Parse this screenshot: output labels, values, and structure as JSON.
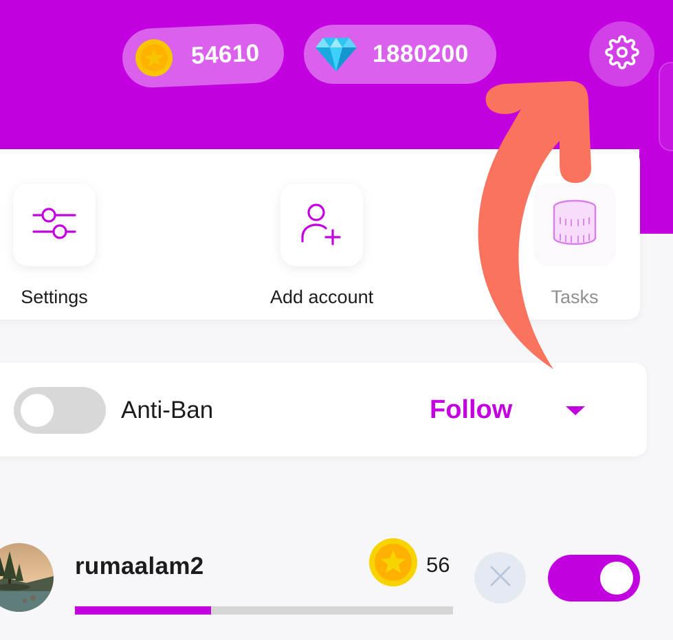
{
  "balances": {
    "coins": "54610",
    "gems": "1880200"
  },
  "icons": {
    "coin": "coin-star-icon",
    "gem": "diamond-icon",
    "settings_top": "gear-icon",
    "settings_action": "sliders-icon",
    "add_account": "user-plus-icon",
    "tasks": "coin-stack-icon",
    "dismiss": "close-icon"
  },
  "actions": [
    {
      "label": "Settings"
    },
    {
      "label": "Add account"
    },
    {
      "label": "Tasks"
    }
  ],
  "mode_bar": {
    "anti_ban_label": "Anti-Ban",
    "anti_ban_on": false,
    "mode_selected": "Follow"
  },
  "task_row": {
    "username": "rumaalam2",
    "reward": "56",
    "enabled": true,
    "progress": 0.36
  },
  "colors": {
    "brand": "#c300e0",
    "arrow": "#f9735f",
    "coin_gold": "#f7c600",
    "gem_blue": "#2ec5f2"
  }
}
